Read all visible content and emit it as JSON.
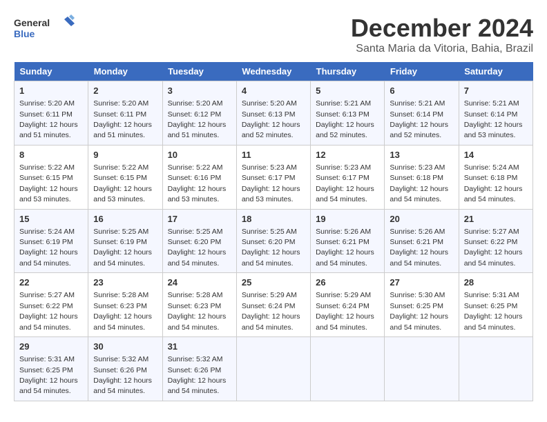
{
  "logo": {
    "line1": "General",
    "line2": "Blue"
  },
  "title": "December 2024",
  "subtitle": "Santa Maria da Vitoria, Bahia, Brazil",
  "days_of_week": [
    "Sunday",
    "Monday",
    "Tuesday",
    "Wednesday",
    "Thursday",
    "Friday",
    "Saturday"
  ],
  "weeks": [
    [
      {
        "day": "1",
        "info": "Sunrise: 5:20 AM\nSunset: 6:11 PM\nDaylight: 12 hours\nand 51 minutes."
      },
      {
        "day": "2",
        "info": "Sunrise: 5:20 AM\nSunset: 6:11 PM\nDaylight: 12 hours\nand 51 minutes."
      },
      {
        "day": "3",
        "info": "Sunrise: 5:20 AM\nSunset: 6:12 PM\nDaylight: 12 hours\nand 51 minutes."
      },
      {
        "day": "4",
        "info": "Sunrise: 5:20 AM\nSunset: 6:13 PM\nDaylight: 12 hours\nand 52 minutes."
      },
      {
        "day": "5",
        "info": "Sunrise: 5:21 AM\nSunset: 6:13 PM\nDaylight: 12 hours\nand 52 minutes."
      },
      {
        "day": "6",
        "info": "Sunrise: 5:21 AM\nSunset: 6:14 PM\nDaylight: 12 hours\nand 52 minutes."
      },
      {
        "day": "7",
        "info": "Sunrise: 5:21 AM\nSunset: 6:14 PM\nDaylight: 12 hours\nand 53 minutes."
      }
    ],
    [
      {
        "day": "8",
        "info": "Sunrise: 5:22 AM\nSunset: 6:15 PM\nDaylight: 12 hours\nand 53 minutes."
      },
      {
        "day": "9",
        "info": "Sunrise: 5:22 AM\nSunset: 6:15 PM\nDaylight: 12 hours\nand 53 minutes."
      },
      {
        "day": "10",
        "info": "Sunrise: 5:22 AM\nSunset: 6:16 PM\nDaylight: 12 hours\nand 53 minutes."
      },
      {
        "day": "11",
        "info": "Sunrise: 5:23 AM\nSunset: 6:17 PM\nDaylight: 12 hours\nand 53 minutes."
      },
      {
        "day": "12",
        "info": "Sunrise: 5:23 AM\nSunset: 6:17 PM\nDaylight: 12 hours\nand 54 minutes."
      },
      {
        "day": "13",
        "info": "Sunrise: 5:23 AM\nSunset: 6:18 PM\nDaylight: 12 hours\nand 54 minutes."
      },
      {
        "day": "14",
        "info": "Sunrise: 5:24 AM\nSunset: 6:18 PM\nDaylight: 12 hours\nand 54 minutes."
      }
    ],
    [
      {
        "day": "15",
        "info": "Sunrise: 5:24 AM\nSunset: 6:19 PM\nDaylight: 12 hours\nand 54 minutes."
      },
      {
        "day": "16",
        "info": "Sunrise: 5:25 AM\nSunset: 6:19 PM\nDaylight: 12 hours\nand 54 minutes."
      },
      {
        "day": "17",
        "info": "Sunrise: 5:25 AM\nSunset: 6:20 PM\nDaylight: 12 hours\nand 54 minutes."
      },
      {
        "day": "18",
        "info": "Sunrise: 5:25 AM\nSunset: 6:20 PM\nDaylight: 12 hours\nand 54 minutes."
      },
      {
        "day": "19",
        "info": "Sunrise: 5:26 AM\nSunset: 6:21 PM\nDaylight: 12 hours\nand 54 minutes."
      },
      {
        "day": "20",
        "info": "Sunrise: 5:26 AM\nSunset: 6:21 PM\nDaylight: 12 hours\nand 54 minutes."
      },
      {
        "day": "21",
        "info": "Sunrise: 5:27 AM\nSunset: 6:22 PM\nDaylight: 12 hours\nand 54 minutes."
      }
    ],
    [
      {
        "day": "22",
        "info": "Sunrise: 5:27 AM\nSunset: 6:22 PM\nDaylight: 12 hours\nand 54 minutes."
      },
      {
        "day": "23",
        "info": "Sunrise: 5:28 AM\nSunset: 6:23 PM\nDaylight: 12 hours\nand 54 minutes."
      },
      {
        "day": "24",
        "info": "Sunrise: 5:28 AM\nSunset: 6:23 PM\nDaylight: 12 hours\nand 54 minutes."
      },
      {
        "day": "25",
        "info": "Sunrise: 5:29 AM\nSunset: 6:24 PM\nDaylight: 12 hours\nand 54 minutes."
      },
      {
        "day": "26",
        "info": "Sunrise: 5:29 AM\nSunset: 6:24 PM\nDaylight: 12 hours\nand 54 minutes."
      },
      {
        "day": "27",
        "info": "Sunrise: 5:30 AM\nSunset: 6:25 PM\nDaylight: 12 hours\nand 54 minutes."
      },
      {
        "day": "28",
        "info": "Sunrise: 5:31 AM\nSunset: 6:25 PM\nDaylight: 12 hours\nand 54 minutes."
      }
    ],
    [
      {
        "day": "29",
        "info": "Sunrise: 5:31 AM\nSunset: 6:25 PM\nDaylight: 12 hours\nand 54 minutes."
      },
      {
        "day": "30",
        "info": "Sunrise: 5:32 AM\nSunset: 6:26 PM\nDaylight: 12 hours\nand 54 minutes."
      },
      {
        "day": "31",
        "info": "Sunrise: 5:32 AM\nSunset: 6:26 PM\nDaylight: 12 hours\nand 54 minutes."
      },
      {
        "day": "",
        "info": ""
      },
      {
        "day": "",
        "info": ""
      },
      {
        "day": "",
        "info": ""
      },
      {
        "day": "",
        "info": ""
      }
    ]
  ]
}
